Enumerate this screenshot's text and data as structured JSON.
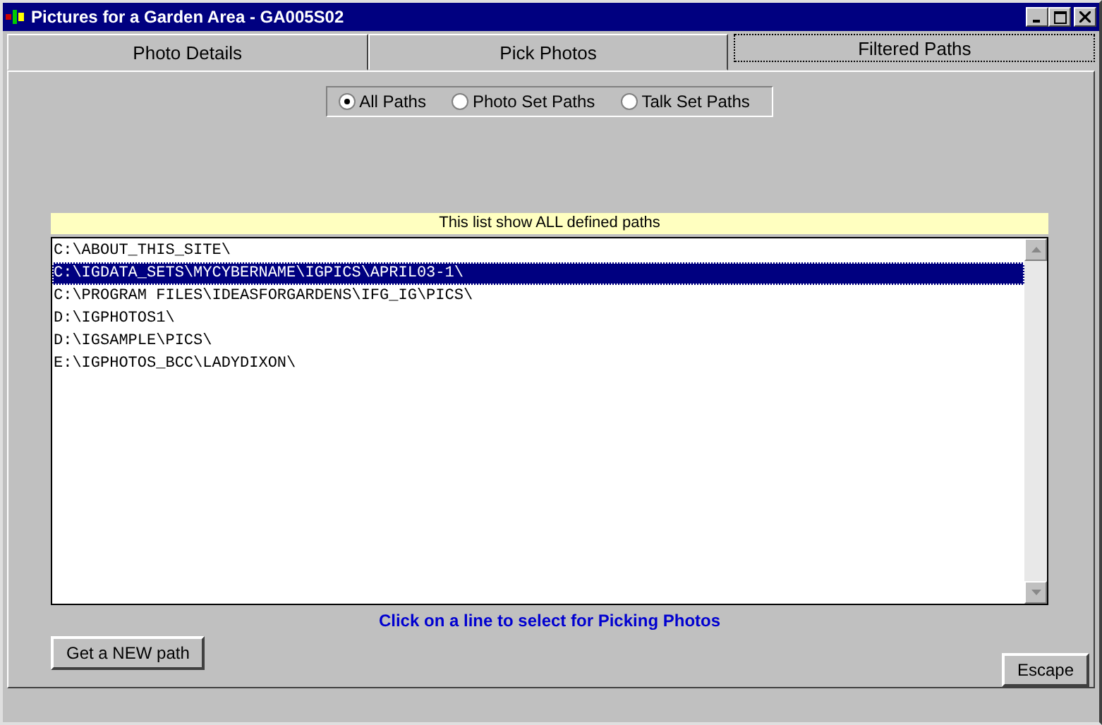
{
  "window": {
    "title": "Pictures for a Garden Area - GA005S02"
  },
  "tabs": [
    {
      "label": "Photo Details",
      "selected": false
    },
    {
      "label": "Pick Photos",
      "selected": false
    },
    {
      "label": "Filtered Paths",
      "selected": true
    }
  ],
  "path_filter": [
    {
      "label": "All Paths",
      "selected": true
    },
    {
      "label": "Photo Set Paths",
      "selected": false
    },
    {
      "label": "Talk Set Paths",
      "selected": false
    }
  ],
  "list": {
    "header": "This list show ALL defined paths",
    "rows": [
      {
        "text": "C:\\ABOUT_THIS_SITE\\",
        "selected": false
      },
      {
        "text": "C:\\IGDATA_SETS\\MYCYBERNAME\\IGPICS\\APRIL03-1\\",
        "selected": true
      },
      {
        "text": "C:\\PROGRAM FILES\\IDEASFORGARDENS\\IFG_IG\\PICS\\",
        "selected": false
      },
      {
        "text": "D:\\IGPHOTOS1\\",
        "selected": false
      },
      {
        "text": "D:\\IGSAMPLE\\PICS\\",
        "selected": false
      },
      {
        "text": "E:\\IGPHOTOS_BCC\\LADYDIXON\\",
        "selected": false
      }
    ]
  },
  "hint": "Click on a line to select for Picking Photos",
  "buttons": {
    "new_path": "Get a NEW path",
    "escape": "Escape"
  }
}
